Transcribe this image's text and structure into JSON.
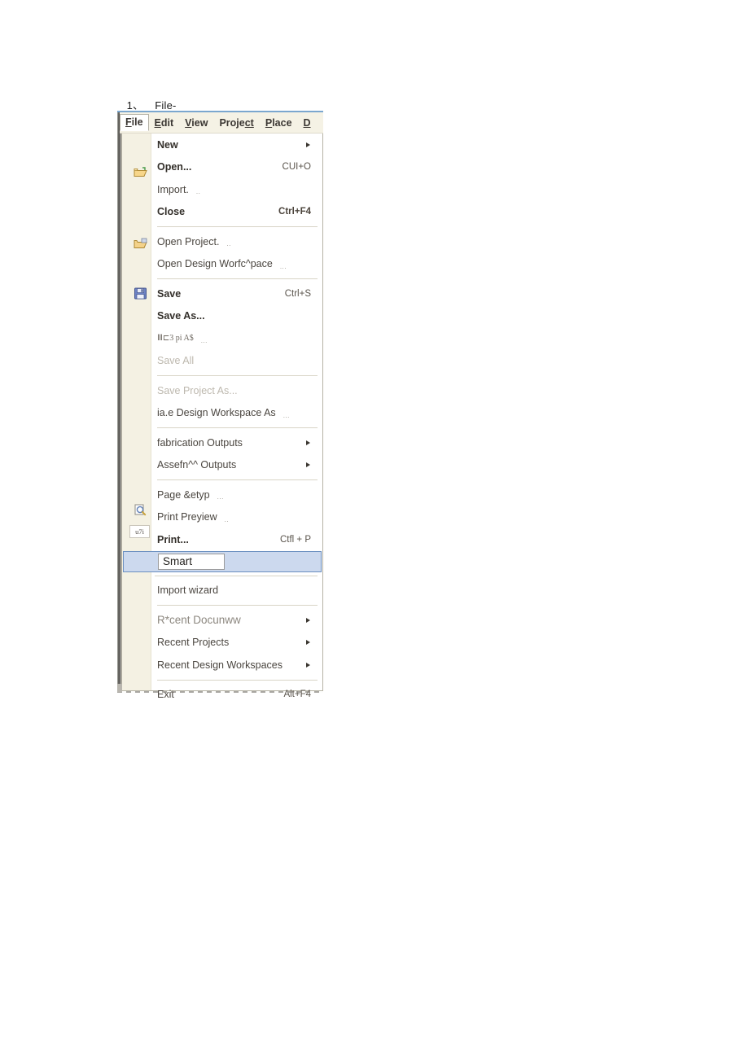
{
  "heading": {
    "number": "1、",
    "label": "File-"
  },
  "menubar": {
    "items": [
      {
        "mnemonic": "F",
        "rest": "ile",
        "active": true
      },
      {
        "mnemonic": "E",
        "rest": "dit",
        "active": false
      },
      {
        "mnemonic": "V",
        "rest": "iew",
        "active": false
      },
      {
        "mnemonic": "Proje",
        "rest": "ct",
        "active": false
      },
      {
        "mnemonic": "P",
        "rest": "lace",
        "active": false
      },
      {
        "mnemonic": "D",
        "rest": "",
        "active": false
      }
    ]
  },
  "file_menu": {
    "groups": [
      {
        "items": [
          {
            "label": "New",
            "accel": "",
            "arrow": true,
            "bold": true,
            "icon": "",
            "dots": ""
          },
          {
            "label": "Open...",
            "accel": "CUI+O",
            "arrow": false,
            "bold": true,
            "icon": "open-folder-icon",
            "dots": ""
          },
          {
            "label": "Import.",
            "accel": "",
            "arrow": false,
            "bold": false,
            "icon": "",
            "dots": ".."
          },
          {
            "label": "Close",
            "accel": "Ctrl+F4",
            "arrow": false,
            "bold": true,
            "icon": "",
            "dots": ""
          }
        ]
      },
      {
        "items": [
          {
            "label": "Open Project.",
            "accel": "",
            "arrow": false,
            "bold": false,
            "icon": "open-project-folder-icon",
            "dots": ".."
          },
          {
            "label": "Open Design Worfc^pace",
            "accel": "",
            "arrow": false,
            "bold": false,
            "icon": "",
            "dots": "..."
          }
        ]
      },
      {
        "items": [
          {
            "label": "Save",
            "accel": "Ctrl+S",
            "arrow": false,
            "bold": true,
            "icon": "save-floppy-icon",
            "dots": ""
          },
          {
            "label": "Save As...",
            "accel": "",
            "arrow": false,
            "bold": true,
            "icon": "",
            "dots": ""
          },
          {
            "label": "Ⅲ⊏3 pi A$",
            "accel": "",
            "arrow": false,
            "bold": false,
            "icon": "",
            "dots": "..."
          },
          {
            "label": "Save All",
            "accel": "",
            "arrow": false,
            "bold": false,
            "disabled": true,
            "icon": "",
            "dots": ""
          }
        ]
      },
      {
        "items": [
          {
            "label": "Save Project As...",
            "accel": "",
            "arrow": false,
            "bold": false,
            "disabled": true,
            "icon": "",
            "dots": ""
          },
          {
            "label": "ia.e Design Workspace As",
            "accel": "",
            "arrow": false,
            "bold": false,
            "icon": "",
            "dots": "..."
          }
        ]
      },
      {
        "items": [
          {
            "label": "fabrication Outputs",
            "accel": "",
            "arrow": true,
            "bold": false,
            "icon": "",
            "dots": ""
          },
          {
            "label": "Assefn^^ Outputs",
            "accel": "",
            "arrow": true,
            "bold": false,
            "icon": "",
            "dots": ""
          }
        ]
      },
      {
        "items": [
          {
            "label": "Page &etyp",
            "accel": "",
            "arrow": false,
            "bold": false,
            "icon": "",
            "dots": "..."
          },
          {
            "label": "Print Preyiew",
            "accel": "",
            "arrow": false,
            "bold": false,
            "icon": "print-preview-icon",
            "dots": ".."
          },
          {
            "label": "Print...",
            "accel": "Ctfl + P",
            "arrow": false,
            "bold": true,
            "icon": "print-icon",
            "dots": ""
          }
        ]
      },
      {
        "items": [
          {
            "label": "Smart",
            "accel": "",
            "arrow": false,
            "bold": false,
            "selected": true,
            "icon": "smart-pdf-icon",
            "dots": ""
          }
        ]
      },
      {
        "items": [
          {
            "label": "Import wizard",
            "accel": "",
            "arrow": false,
            "bold": false,
            "icon": "",
            "dots": ""
          }
        ]
      },
      {
        "items": [
          {
            "label": "R*cent Docunww",
            "accel": "",
            "arrow": true,
            "bold": false,
            "icon": "",
            "dots": ""
          },
          {
            "label": "Recent Projects",
            "accel": "",
            "arrow": true,
            "bold": false,
            "icon": "",
            "dots": ""
          },
          {
            "label": "Recent Design Workspaces",
            "accel": "",
            "arrow": true,
            "bold": false,
            "icon": "",
            "dots": ""
          }
        ]
      },
      {
        "items": [
          {
            "label": "Exit",
            "accel": "Alt+F4",
            "arrow": false,
            "bold": false,
            "icon": "",
            "dots": ""
          }
        ]
      }
    ],
    "print_icon_badge": "u7i"
  },
  "colors": {
    "menubar_bg": "#f5f2e5",
    "gutter_bg": "#f4f1e3",
    "panel_bg": "#ffffff",
    "selection_bg": "#ccd9ee",
    "selection_border": "#6a8fc0",
    "top_accent": "#7ba7cf",
    "text": "#4a453f",
    "text_disabled": "#bdb8ae"
  }
}
